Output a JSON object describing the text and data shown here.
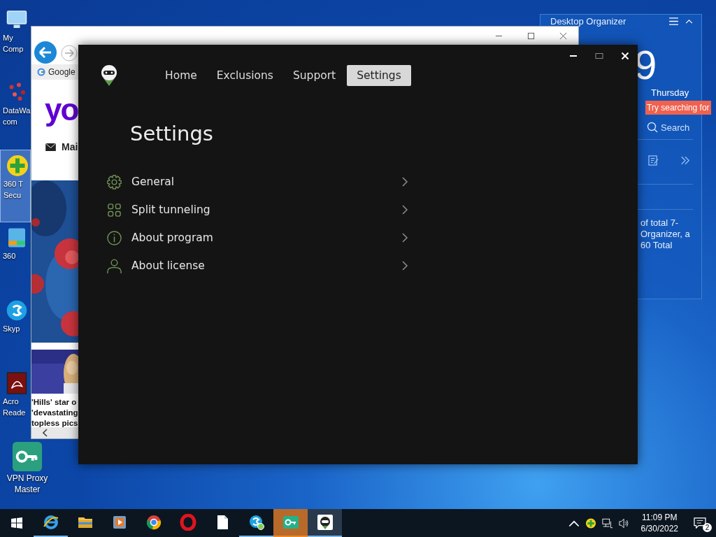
{
  "desktop": {
    "icons": [
      {
        "label": "My Comp",
        "kind": "computer",
        "selected": false
      },
      {
        "label": "DataWa com",
        "kind": "dots",
        "selected": false
      },
      {
        "label": "360 T Secu",
        "kind": "shield360",
        "selected": true
      },
      {
        "label": "360",
        "kind": "zip",
        "selected": false
      },
      {
        "label": "Skyp",
        "kind": "skype",
        "selected": false
      },
      {
        "label": "Acro Reade",
        "kind": "acrobat",
        "selected": false
      },
      {
        "label": "VPN Proxy Master",
        "kind": "vpn",
        "selected": false
      }
    ]
  },
  "browser": {
    "tab": "Google",
    "logo": "yo",
    "mail": "Mai",
    "headline_lines": [
      "'Hills' star o",
      "'devastating",
      "topless pics"
    ]
  },
  "organizer": {
    "title": "Desktop Organizer",
    "clock": "9",
    "day": "Thursday",
    "tooltip": "Try searching for",
    "search": "Search",
    "text_lines": [
      "of total 7-",
      "Organizer, a",
      "60 Total"
    ]
  },
  "app": {
    "tabs": [
      {
        "label": "Home",
        "selected": false
      },
      {
        "label": "Exclusions",
        "selected": false
      },
      {
        "label": "Support",
        "selected": false
      },
      {
        "label": "Settings",
        "selected": true
      }
    ],
    "heading": "Settings",
    "items": [
      {
        "label": "General",
        "kind": "gear"
      },
      {
        "label": "Split tunneling",
        "kind": "grid"
      },
      {
        "label": "About program",
        "kind": "info"
      },
      {
        "label": "About license",
        "kind": "person"
      }
    ]
  },
  "taskbar": {
    "apps": [
      {
        "kind": "ie",
        "running": true,
        "selected": false,
        "flashing": false
      },
      {
        "kind": "folder",
        "running": false,
        "selected": false,
        "flashing": false
      },
      {
        "kind": "media",
        "running": false,
        "selected": false,
        "flashing": false
      },
      {
        "kind": "chrome",
        "running": false,
        "selected": false,
        "flashing": false
      },
      {
        "kind": "opera",
        "running": false,
        "selected": false,
        "flashing": false
      },
      {
        "kind": "file",
        "running": false,
        "selected": false,
        "flashing": false
      },
      {
        "kind": "skype",
        "running": true,
        "selected": false,
        "flashing": false
      },
      {
        "kind": "vpn",
        "running": true,
        "selected": false,
        "flashing": true
      },
      {
        "kind": "robot",
        "running": true,
        "selected": true,
        "flashing": false
      }
    ],
    "time": "11:09 PM",
    "date": "6/30/2022",
    "notifications": "2"
  }
}
